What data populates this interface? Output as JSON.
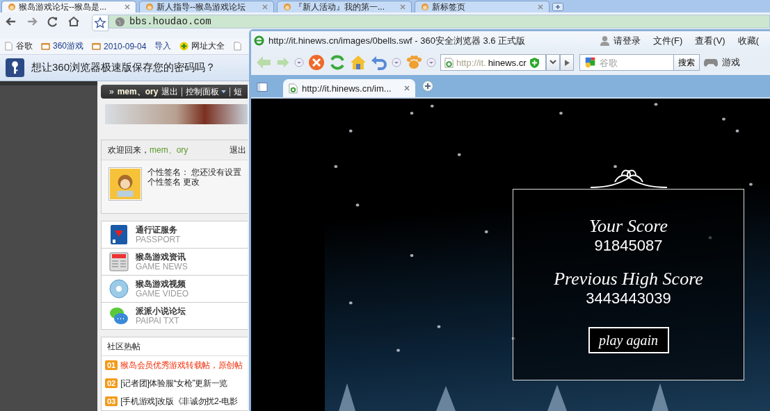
{
  "back_browser": {
    "tabs": [
      {
        "title": "猴岛游戏论坛--猴岛是...",
        "selected": true
      },
      {
        "title": "新人指导--猴岛游戏论坛",
        "selected": false
      },
      {
        "title": "『新人活动』我的第一...",
        "selected": false
      },
      {
        "title": "新标签页",
        "selected": false
      }
    ],
    "address": "bbs.houdao.com",
    "bookmarks": [
      {
        "label": "谷歌",
        "kind": "page"
      },
      {
        "label": "360游戏",
        "kind": "folder"
      },
      {
        "label": "2010-09-04",
        "kind": "folder"
      },
      {
        "label": "导入",
        "kind": "link"
      },
      {
        "label": "网址大全",
        "kind": "site"
      }
    ],
    "infobar": "想让360浏览器极速版保存您的密码吗？",
    "page": {
      "user_bar": {
        "prefix": "»",
        "username": "mem、ory",
        "links": [
          {
            "label": "退出",
            "menu": false
          },
          {
            "label": "控制面板",
            "menu": true
          },
          {
            "label": "短",
            "menu": false
          }
        ]
      },
      "welcome": {
        "greeting": "欢迎回来，",
        "username": "mem、ory",
        "logout": "退出",
        "signature_label": "个性签名：",
        "signature_value": "您还没有设置",
        "signature_line2": "个性签名",
        "edit": "更改"
      },
      "services": [
        {
          "title": "通行证服务",
          "subtitle": "PASSPORT",
          "kind": "passport"
        },
        {
          "title": "猴岛游戏资讯",
          "subtitle": "GAME NEWS",
          "kind": "news"
        },
        {
          "title": "猴岛游戏视频",
          "subtitle": "GAME VIDEO",
          "kind": "video"
        },
        {
          "title": "派派小说论坛",
          "subtitle": "PAIPAI TXT",
          "kind": "chat"
        }
      ],
      "hot_posts": {
        "title": "社区热帖",
        "items": [
          {
            "rank": "01",
            "text": "猴岛会员优秀游戏转载帖，原创帖",
            "highlight": true
          },
          {
            "rank": "02",
            "text": "[记者团]体验服“女枪”更新一览",
            "highlight": false
          },
          {
            "rank": "03",
            "text": "[手机游戏]改版《非诚勿扰2-电影",
            "highlight": false
          }
        ]
      }
    }
  },
  "front_window": {
    "title": "http://it.hinews.cn/images/0bells.swf - 360安全浏览器 3.6 正式版",
    "login": "请登录",
    "menus": [
      "文件(F)",
      "查看(V)",
      "收藏("
    ],
    "address_prefix": "http://it.",
    "address_host": "hinews.cr",
    "search_placeholder": "谷歌",
    "search_button": "搜索",
    "games": "游戏",
    "tabs": [
      {
        "title": "http://it.hinews.cn/im...",
        "selected": true
      }
    ],
    "game": {
      "score_label": "Your Score",
      "score": "91845087",
      "high_label": "Previous High Score",
      "high_score": "3443443039",
      "button": "play again"
    }
  }
}
